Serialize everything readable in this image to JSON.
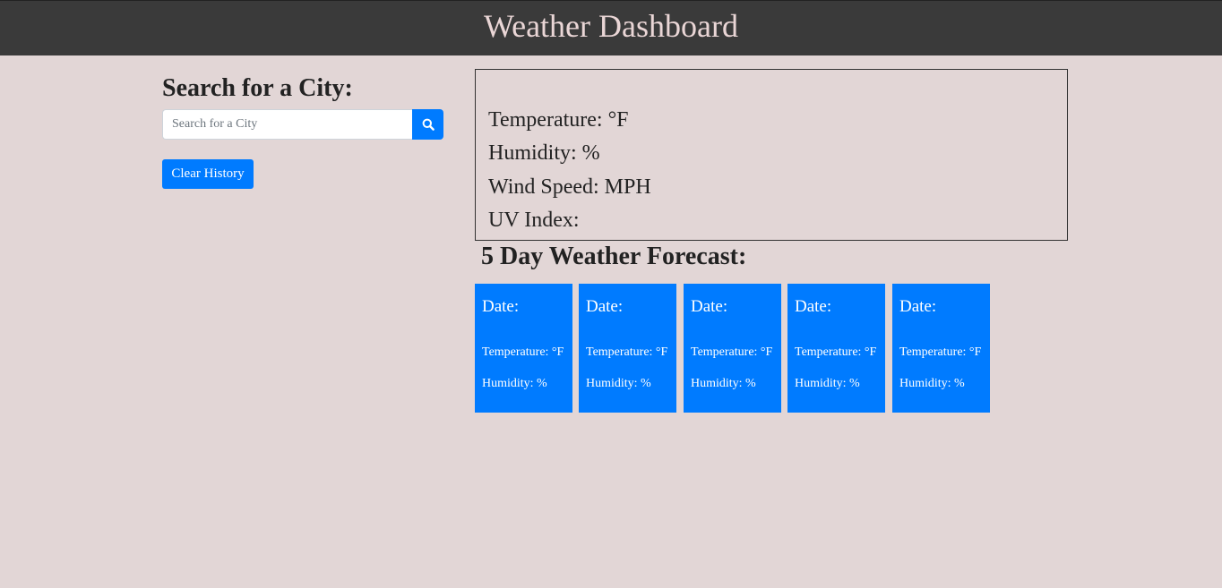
{
  "header": {
    "title": "Weather Dashboard",
    "bg_color": "#3a3a3a",
    "title_color": "#ead6d6"
  },
  "search": {
    "heading": "Search for a City:",
    "placeholder": "Search for a City",
    "value": "",
    "button_icon": "search-icon",
    "clear_label": "Clear History",
    "accent_color": "#007bff"
  },
  "current": {
    "temperature": "Temperature: °F",
    "humidity": "Humidity: %",
    "wind": "Wind Speed: MPH",
    "uv": "UV Index:"
  },
  "forecast": {
    "heading": "5 Day Weather Forecast:",
    "days": [
      {
        "date": "Date:",
        "temp": "Temperature: °F",
        "humidity": "Humidity: %"
      },
      {
        "date": "Date:",
        "temp": "Temperature: °F",
        "humidity": "Humidity: %"
      },
      {
        "date": "Date:",
        "temp": "Temperature: °F",
        "humidity": "Humidity: %"
      },
      {
        "date": "Date:",
        "temp": "Temperature: °F",
        "humidity": "Humidity: %"
      },
      {
        "date": "Date:",
        "temp": "Temperature: °F",
        "humidity": "Humidity: %"
      }
    ]
  },
  "page": {
    "bg_color": "#e2d6d6"
  }
}
